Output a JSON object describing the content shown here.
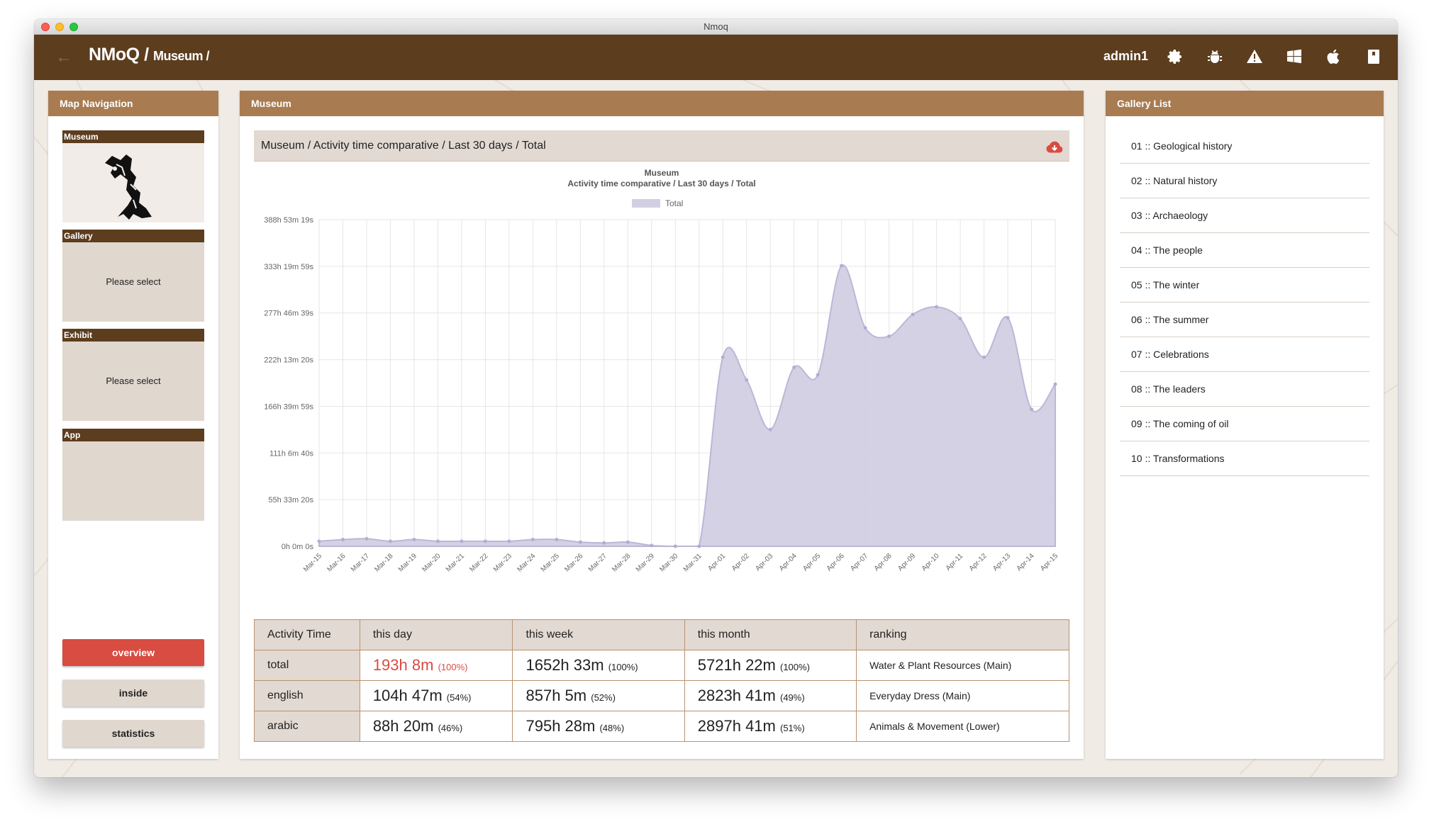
{
  "window": {
    "title": "Nmoq"
  },
  "header": {
    "app_name": "NMoQ",
    "sep": "/",
    "section": "Museum /",
    "user": "admin1",
    "icons": [
      "gear-icon",
      "bug-icon",
      "warning-icon",
      "windows-icon",
      "apple-icon",
      "tablet-icon"
    ]
  },
  "left": {
    "title": "Map Navigation",
    "blocks": [
      {
        "label": "Museum",
        "text": ""
      },
      {
        "label": "Gallery",
        "text": "Please select"
      },
      {
        "label": "Exhibit",
        "text": "Please select"
      },
      {
        "label": "App",
        "text": ""
      }
    ],
    "buttons": {
      "overview": "overview",
      "inside": "inside",
      "statistics": "statistics"
    }
  },
  "center": {
    "title": "Museum",
    "chart_bar_title": "Museum / Activity time comparative / Last 30 days / Total",
    "table": {
      "headers": [
        "Activity Time",
        "this day",
        "this week",
        "this month",
        "ranking"
      ],
      "rows": [
        {
          "label": "total",
          "day": "193h 8m",
          "day_pct": "(100%)",
          "week": "1652h 33m",
          "week_pct": "(100%)",
          "month": "5721h 22m",
          "month_pct": "(100%)",
          "rank": "Water & Plant Resources (Main)"
        },
        {
          "label": "english",
          "day": "104h 47m",
          "day_pct": "(54%)",
          "week": "857h 5m",
          "week_pct": "(52%)",
          "month": "2823h 41m",
          "month_pct": "(49%)",
          "rank": "Everyday Dress (Main)"
        },
        {
          "label": "arabic",
          "day": "88h 20m",
          "day_pct": "(46%)",
          "week": "795h 28m",
          "week_pct": "(48%)",
          "month": "2897h 41m",
          "month_pct": "(51%)",
          "rank": "Animals & Movement (Lower)"
        }
      ]
    }
  },
  "right": {
    "title": "Gallery List",
    "items": [
      "01 :: Geological history",
      "02 :: Natural history",
      "03 :: Archaeology",
      "04 :: The people",
      "05 :: The winter",
      "06 :: The summer",
      "07 :: Celebrations",
      "08 :: The leaders",
      "09 :: The coming of oil",
      "10 :: Transformations"
    ]
  },
  "colors": {
    "brown_dark": "#5c3d1e",
    "brown_light": "#a87b50",
    "accent_red": "#d84c42",
    "series_fill": "#d3cfe3",
    "series_line": "#bdb6d6"
  },
  "chart_data": {
    "type": "area",
    "title": "Museum",
    "subtitle": "Activity time comparative / Last 30 days / Total",
    "legend": [
      "Total"
    ],
    "legend_position": "top-center",
    "grid": true,
    "yticks": [
      "388h 53m 19s",
      "333h 19m 59s",
      "277h 46m 39s",
      "222h 13m 20s",
      "166h 39m 59s",
      "111h 6m 40s",
      "55h 33m 20s",
      "0h 0m 0s"
    ],
    "ylim": [
      0,
      388.89
    ],
    "x": [
      "Mar-15",
      "Mar-16",
      "Mar-17",
      "Mar-18",
      "Mar-19",
      "Mar-20",
      "Mar-21",
      "Mar-22",
      "Mar-23",
      "Mar-24",
      "Mar-25",
      "Mar-26",
      "Mar-27",
      "Mar-28",
      "Mar-29",
      "Mar-30",
      "Mar-31",
      "Apr-01",
      "Apr-02",
      "Apr-03",
      "Apr-04",
      "Apr-05",
      "Apr-06",
      "Apr-07",
      "Apr-08",
      "Apr-09",
      "Apr-10",
      "Apr-11",
      "Apr-12",
      "Apr-13",
      "Apr-14",
      "Apr-15"
    ],
    "series": [
      {
        "name": "Total",
        "values": [
          6,
          8,
          9,
          6,
          8,
          6,
          6,
          6,
          6,
          8,
          8,
          5,
          4,
          5,
          1,
          0,
          0,
          225,
          198,
          139,
          213,
          204,
          334,
          260,
          250,
          276,
          285,
          271,
          225,
          272,
          163,
          193
        ]
      }
    ]
  }
}
